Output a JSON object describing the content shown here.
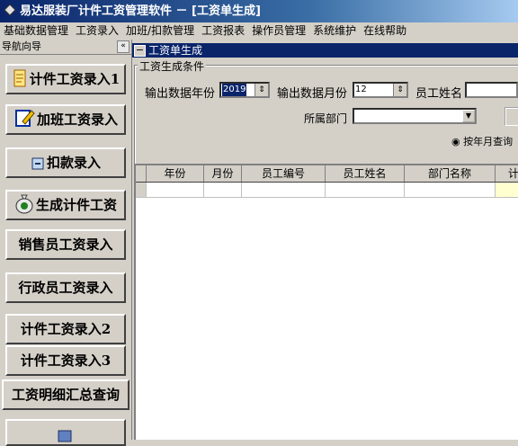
{
  "window": {
    "title": "易达服装厂计件工资管理软件 － [工资单生成]"
  },
  "menu": [
    "基础数据管理",
    "工资录入",
    "加班/扣款管理",
    "工资报表",
    "操作员管理",
    "系统维护",
    "在线帮助"
  ],
  "sidebar": {
    "header": "导航向导",
    "collapse": "«",
    "items": [
      {
        "label": "计件工资录入1",
        "icon": "note-icon"
      },
      {
        "label": "加班工资录入",
        "icon": "edit-icon"
      },
      {
        "label": "扣款录入",
        "icon": "deduct-icon"
      },
      {
        "label": "生成计件工资",
        "icon": "money-bag-icon"
      },
      {
        "label": "销售员工资录入",
        "icon": ""
      },
      {
        "label": "行政员工资录入",
        "icon": ""
      },
      {
        "label": "计件工资录入2",
        "icon": ""
      },
      {
        "label": "计件工资录入3",
        "icon": ""
      },
      {
        "label": "工资明细汇总查询",
        "icon": ""
      }
    ]
  },
  "panel": {
    "title": "工资单生成",
    "group_legend": "工资生成条件",
    "year_label": "输出数据年份",
    "year_value": "2019",
    "month_label": "输出数据月份",
    "month_value": "12",
    "name_label": "员工姓名",
    "dept_label": "所属部门",
    "radio_label": "按年月查询"
  },
  "table": {
    "columns": [
      "",
      "年份",
      "月份",
      "员工编号",
      "员工姓名",
      "部门名称",
      "计"
    ]
  },
  "colors": {
    "title_bar": "#0a246a",
    "panel_header": "#0a246a",
    "selection": "#0a246a"
  }
}
